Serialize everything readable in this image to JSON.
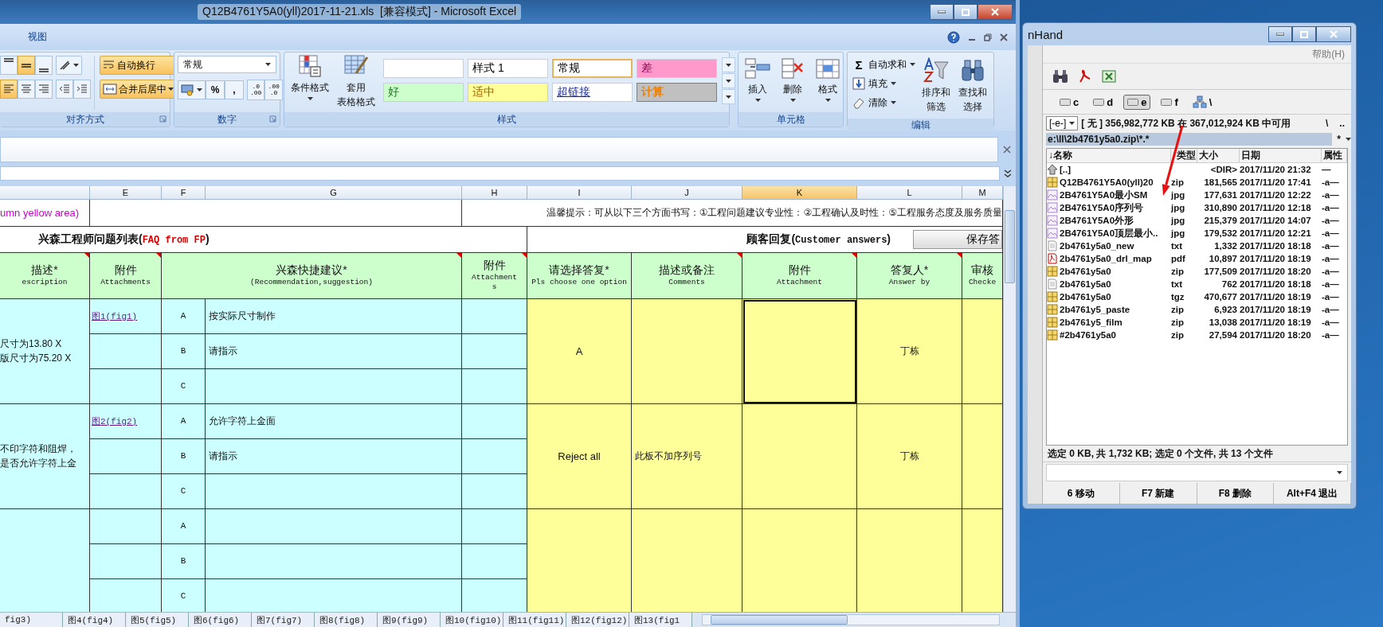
{
  "excel": {
    "title": "Q12B4761Y5A0(yll)2017-11-21.xls  [兼容模式] - Microsoft Excel",
    "tabs": [
      {
        "label": "视图",
        "selected": false
      }
    ],
    "ribbon": {
      "alignment": {
        "label": "对齐方式",
        "vertical": [
          {
            "selected": false
          },
          {
            "selected": true
          },
          {
            "selected": false
          }
        ],
        "horizontal": [
          {
            "selected": true
          },
          {
            "selected": false
          },
          {
            "selected": false
          }
        ],
        "wrap": {
          "label": "自动换行",
          "selected": true
        },
        "merge": {
          "label": "合并后居中",
          "selected": true
        }
      },
      "number": {
        "label": "数字",
        "format": "常规",
        "symbols": [
          "%",
          ","
        ],
        "decimals": [
          ".0\n.00",
          ".00\n.0"
        ]
      },
      "styles": {
        "label": "样式",
        "buttons": [
          [
            "条件格式"
          ],
          [
            "套用",
            "表格格式"
          ]
        ],
        "gallery": [
          {
            "kind": "blank"
          },
          {
            "kind": "plain",
            "label": "样式 1"
          },
          {
            "kind": "normal",
            "label": "常规"
          },
          {
            "kind": "bad",
            "label": "差"
          },
          {
            "kind": "good",
            "label": "好"
          },
          {
            "kind": "neutral",
            "label": "适中"
          },
          {
            "kind": "link",
            "label": "超链接"
          },
          {
            "kind": "calc",
            "label": "计算"
          }
        ]
      },
      "cells": {
        "label": "单元格",
        "buttons": [
          {
            "kind": "insert",
            "label": "插入"
          },
          {
            "kind": "delete",
            "label": "删除"
          },
          {
            "kind": "format",
            "label": "格式"
          }
        ]
      },
      "editing": {
        "label": "编辑",
        "sum_symbol": "Σ",
        "small": [
          {
            "kind": "sum",
            "label": "自动求和"
          },
          {
            "kind": "fill",
            "label": "填充"
          },
          {
            "kind": "clear",
            "label": "清除"
          }
        ],
        "large": [
          {
            "kind": "sort",
            "lines": [
              "排序和",
              "筛选"
            ]
          },
          {
            "kind": "find",
            "lines": [
              "查找和",
              "选择"
            ]
          }
        ]
      }
    },
    "sheet": {
      "columns": [
        {
          "label": "E",
          "selected": false
        },
        {
          "label": "F",
          "selected": false
        },
        {
          "label": "G",
          "selected": false
        },
        {
          "label": "H",
          "selected": false
        },
        {
          "label": "I",
          "selected": false
        },
        {
          "label": "J",
          "selected": false
        },
        {
          "label": "K",
          "selected": true
        },
        {
          "label": "L",
          "selected": false
        },
        {
          "label": "M",
          "selected": false
        }
      ],
      "note": "umn yellow area)",
      "tip": "温馨提示：可从以下三个方面书写：①工程问题建议专业性：②工程确认及时性：⑤工程服务态度及服务质量",
      "left_title": "兴森工程师问题列表(**FAQ from FP**)",
      "right_title": "顾客回复(**Customer answers**)",
      "save_button": "保存答",
      "headers": [
        {
          "title": "描述*",
          "subtitle": "escription",
          "comment": true
        },
        {
          "title": "附件",
          "subtitle": "Attachments",
          "comment": true
        },
        {
          "title": "兴森快捷建议*",
          "subtitle": "(Recommendation,suggestion)",
          "comment": true
        },
        {
          "title": "附件",
          "subtitle": "Attachment\ns",
          "comment": true
        },
        {
          "title": "请选择答复*",
          "subtitle": "Pls choose one option",
          "comment": false
        },
        {
          "title": "描述或备注",
          "subtitle": "Comments",
          "comment": true
        },
        {
          "title": "附件",
          "subtitle": "Attachment",
          "comment": true
        },
        {
          "title": "答复人*",
          "subtitle": "Answer by",
          "comment": true
        },
        {
          "title": "审核",
          "subtitle": "Checke",
          "comment": false
        }
      ],
      "groups": [
        {
          "description": [
            "尺寸为13.80 X",
            "版尺寸为75.20 X"
          ],
          "attachment_link": "图1(fig1)",
          "options": [
            {
              "letter": "A",
              "suggestion": "按实际尺寸制作"
            },
            {
              "letter": "B",
              "suggestion": "请指示"
            },
            {
              "letter": "C"
            }
          ],
          "answer": "A",
          "answer_by": "丁栋",
          "attachment_selected": true
        },
        {
          "description": [
            "不印字符和阻焊，",
            "是否允许字符上金"
          ],
          "attachment_link": "图2(fig2)",
          "options": [
            {
              "letter": "A",
              "suggestion": "允许字符上金面"
            },
            {
              "letter": "B",
              "suggestion": "请指示"
            },
            {
              "letter": "C"
            }
          ],
          "answer": "Reject all",
          "comments": "此板不加序列号",
          "answer_by": "丁栋",
          "attachment_selected": false
        },
        {
          "options": [
            {
              "letter": "A"
            },
            {
              "letter": "B"
            },
            {
              "letter": "C"
            }
          ],
          "attachment_selected": false
        }
      ]
    },
    "sheet_tabs": [
      {
        "label": "fig3)",
        "selected": false
      },
      {
        "label": "图4(fig4)",
        "selected": false
      },
      {
        "label": "图5(fig5)",
        "selected": false
      },
      {
        "label": "图6(fig6)",
        "selected": false
      },
      {
        "label": "图7(fig7)",
        "selected": false
      },
      {
        "label": "图8(fig8)",
        "selected": false
      },
      {
        "label": "图9(fig9)",
        "selected": false
      },
      {
        "label": "图10(fig10)",
        "selected": false
      },
      {
        "label": "图11(fig11)",
        "selected": false
      },
      {
        "label": "图12(fig12)",
        "selected": false
      },
      {
        "label": "图13(fig1",
        "selected": false
      }
    ]
  },
  "file_manager": {
    "title": "nHand",
    "menu": [
      "帮助(H)"
    ],
    "drives": [
      {
        "label": "c",
        "selected": false
      },
      {
        "label": "d",
        "selected": false
      },
      {
        "label": "e",
        "selected": true
      },
      {
        "label": "f",
        "selected": false
      }
    ],
    "root": "\\",
    "drive_select": "[-e-]",
    "free_space": "[ 无 ]  356,982,772 KB 在 367,012,924 KB 中可用",
    "nav": [
      "\\",
      ".."
    ],
    "path": "e:\\ll\\2b4761y5a0.zip\\*.*",
    "filter": "*",
    "columns": [
      "↓名称",
      "类型",
      "大小",
      "日期",
      "属性"
    ],
    "files": [
      {
        "kind": "up",
        "name": "[..]",
        "size": "<DIR>",
        "date": "2017/11/20 21:32",
        "attr": "—"
      },
      {
        "kind": "zip",
        "name": "Q12B4761Y5A0(yll)20",
        "type": "zip",
        "size": "181,565",
        "date": "2017/11/20 17:41",
        "attr": "-a—"
      },
      {
        "kind": "image",
        "name": "2B4761Y5A0最小SM",
        "type": "jpg",
        "size": "177,631",
        "date": "2017/11/20 12:22",
        "attr": "-a—"
      },
      {
        "kind": "image",
        "name": "2B4761Y5A0序列号",
        "type": "jpg",
        "size": "310,890",
        "date": "2017/11/20 12:18",
        "attr": "-a—"
      },
      {
        "kind": "image",
        "name": "2B4761Y5A0外形",
        "type": "jpg",
        "size": "215,379",
        "date": "2017/11/20 14:07",
        "attr": "-a—"
      },
      {
        "kind": "image",
        "name": "2B4761Y5A0顶层最小..",
        "type": "jpg",
        "size": "179,532",
        "date": "2017/11/20 12:21",
        "attr": "-a—"
      },
      {
        "kind": "text",
        "name": "2b4761y5a0_new",
        "type": "txt",
        "size": "1,332",
        "date": "2017/11/20 18:18",
        "attr": "-a—"
      },
      {
        "kind": "pdf",
        "name": "2b4761y5a0_drl_map",
        "type": "pdf",
        "size": "10,897",
        "date": "2017/11/20 18:19",
        "attr": "-a—"
      },
      {
        "kind": "zip",
        "name": "2b4761y5a0",
        "type": "zip",
        "size": "177,509",
        "date": "2017/11/20 18:20",
        "attr": "-a—"
      },
      {
        "kind": "text",
        "name": "2b4761y5a0",
        "type": "txt",
        "size": "762",
        "date": "2017/11/20 18:18",
        "attr": "-a—"
      },
      {
        "kind": "zip",
        "name": "2b4761y5a0",
        "type": "tgz",
        "size": "470,677",
        "date": "2017/11/20 18:19",
        "attr": "-a—"
      },
      {
        "kind": "zip",
        "name": "2b4761y5_paste",
        "type": "zip",
        "size": "6,923",
        "date": "2017/11/20 18:19",
        "attr": "-a—"
      },
      {
        "kind": "zip",
        "name": "2b4761y5_film",
        "type": "zip",
        "size": "13,038",
        "date": "2017/11/20 18:19",
        "attr": "-a—"
      },
      {
        "kind": "zip",
        "name": "#2b4761y5a0",
        "type": "zip",
        "size": "27,594",
        "date": "2017/11/20 18:20",
        "attr": "-a—"
      }
    ],
    "status": "选定 0 KB, 共 1,732 KB; 选定 0 个文件, 共 13 个文件",
    "function_keys": [
      "6 移动",
      "F7 新建",
      "F8 删除",
      "Alt+F4 退出"
    ]
  }
}
